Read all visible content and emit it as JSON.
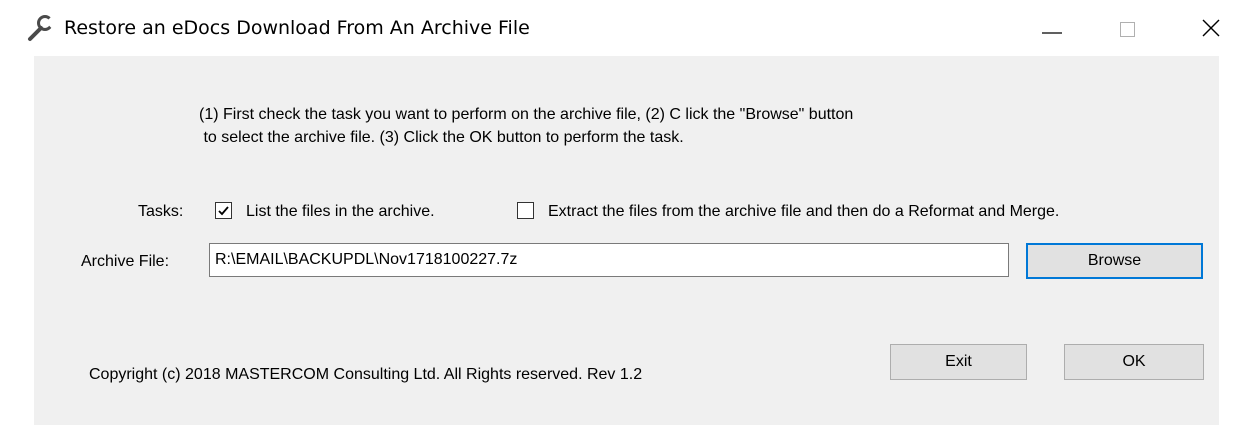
{
  "window": {
    "title": "Restore an eDocs Download From An Archive File",
    "icon": "wrench-icon"
  },
  "instructions": {
    "line1": "(1) First check the task you want to perform on the archive file, (2) C lick the \"Browse\" button",
    "line2": " to select the archive file. (3) Click the OK button to perform the task."
  },
  "tasks": {
    "label": "Tasks:",
    "items": [
      {
        "label": "List the files in the archive.",
        "checked": true
      },
      {
        "label": "Extract the files from the archive file and then do a Reformat and Merge.",
        "checked": false
      }
    ]
  },
  "archive": {
    "label": "Archive File:",
    "value": "R:\\EMAIL\\BACKUPDL\\Nov1718100227.7z",
    "browse_label": "Browse"
  },
  "footer": {
    "copyright": "Copyright (c) 2018 MASTERCOM Consulting Ltd. All Rights reserved.   Rev 1.2",
    "exit_label": "Exit",
    "ok_label": "OK"
  },
  "colors": {
    "client_bg": "#f0f0f0",
    "focus_border": "#0078d7"
  }
}
